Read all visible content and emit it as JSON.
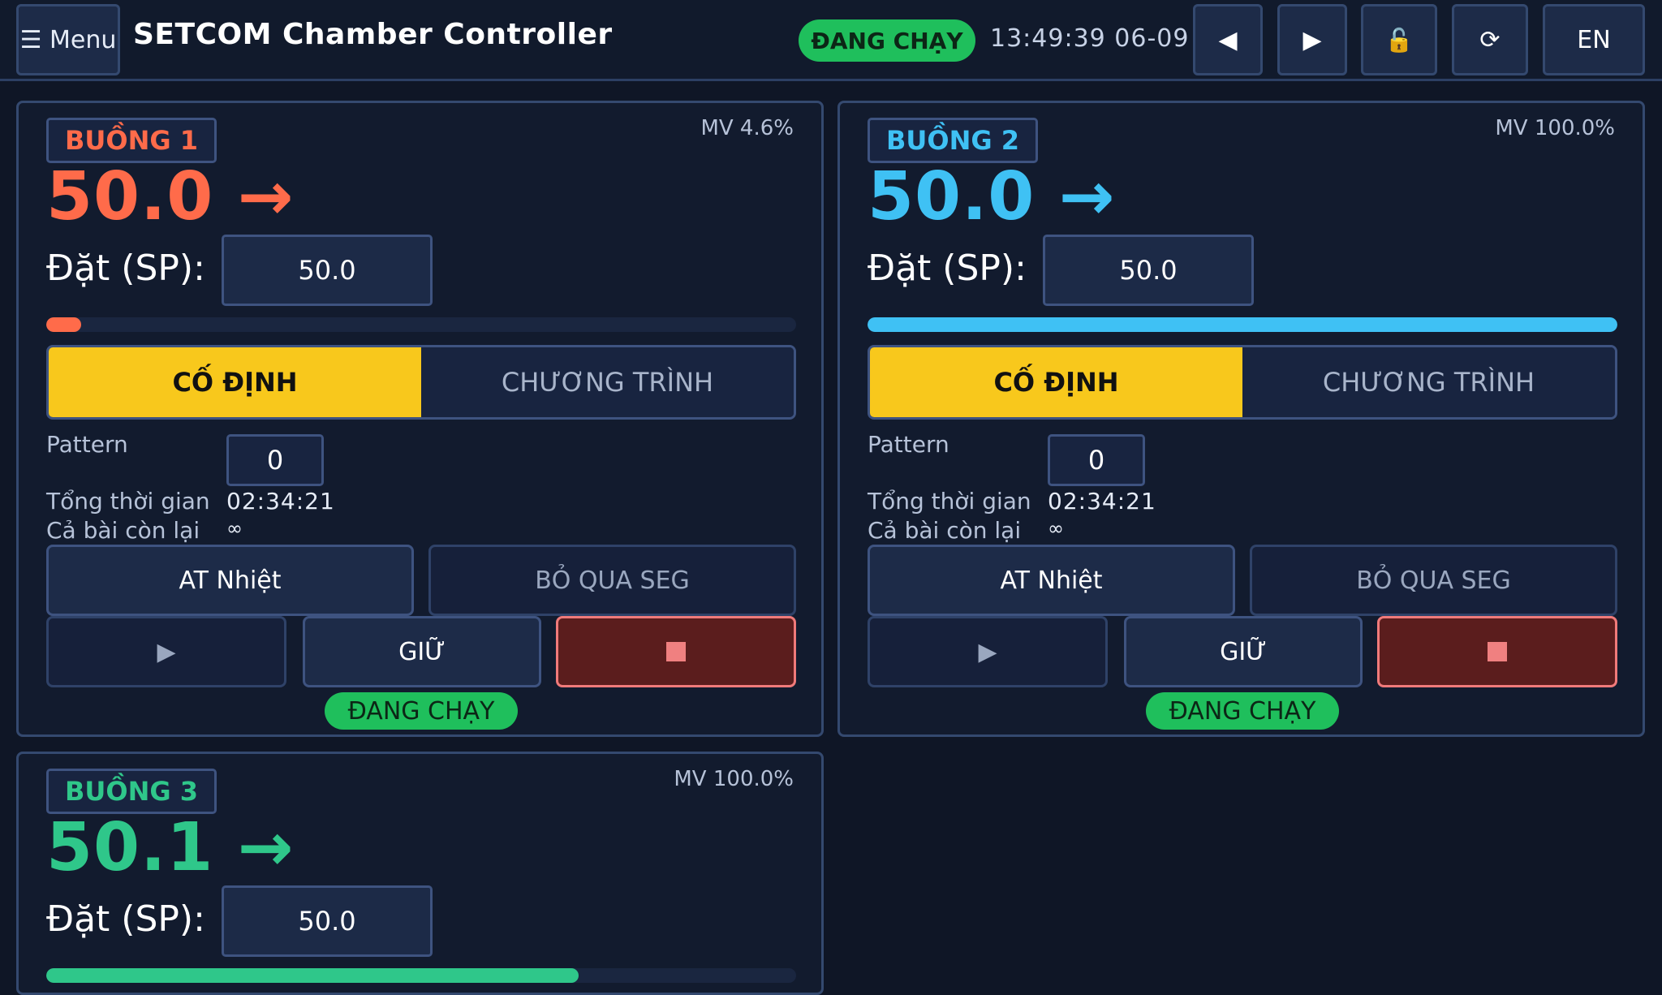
{
  "topbar": {
    "menu_label": "☰ Menu",
    "title": "SETCOM Chamber Controller",
    "run_status": "ĐANG CHẠY",
    "clock": "13:49:39 06-09",
    "prev_icon": "◀",
    "next_icon": "▶",
    "lock_icon": "🔓",
    "refresh_icon": "⟳",
    "language": "EN"
  },
  "chambers": [
    {
      "name": "BUỒNG 1",
      "color": "#ff6b4a",
      "mv": "MV 4.6%",
      "pv": "50.0 →",
      "sp_label": "Đặt (SP):",
      "sp_value": "50.0",
      "output_fraction": 0.046,
      "mode_fixed": "CỐ ĐỊNH",
      "mode_program": "CHƯƠNG TRÌNH",
      "pattern_label": "Pattern",
      "pattern_value": "0",
      "total_time_label": "Tổng thời gian",
      "total_time": "02:34:21",
      "remaining_label": "Cả bài còn lại",
      "remaining": "∞",
      "at_label": "AT Nhiệt",
      "skip_label": "BỎ QUA SEG",
      "play_icon": "▶",
      "hold_label": "GIỮ",
      "status": "ĐANG CHẠY"
    },
    {
      "name": "BUỒNG 2",
      "color": "#3fc1f4",
      "mv": "MV 100.0%",
      "pv": "50.0 →",
      "sp_label": "Đặt (SP):",
      "sp_value": "50.0",
      "output_fraction": 1.0,
      "mode_fixed": "CỐ ĐỊNH",
      "mode_program": "CHƯƠNG TRÌNH",
      "pattern_label": "Pattern",
      "pattern_value": "0",
      "total_time_label": "Tổng thời gian",
      "total_time": "02:34:21",
      "remaining_label": "Cả bài còn lại",
      "remaining": "∞",
      "at_label": "AT Nhiệt",
      "skip_label": "BỎ QUA SEG",
      "play_icon": "▶",
      "hold_label": "GIỮ",
      "status": "ĐANG CHẠY"
    },
    {
      "name": "BUỒNG 3",
      "color": "#2fc78a",
      "mv": "MV 100.0%",
      "pv": "50.1 →",
      "sp_label": "Đặt (SP):",
      "sp_value": "50.0",
      "output_fraction": 0.71
    }
  ]
}
